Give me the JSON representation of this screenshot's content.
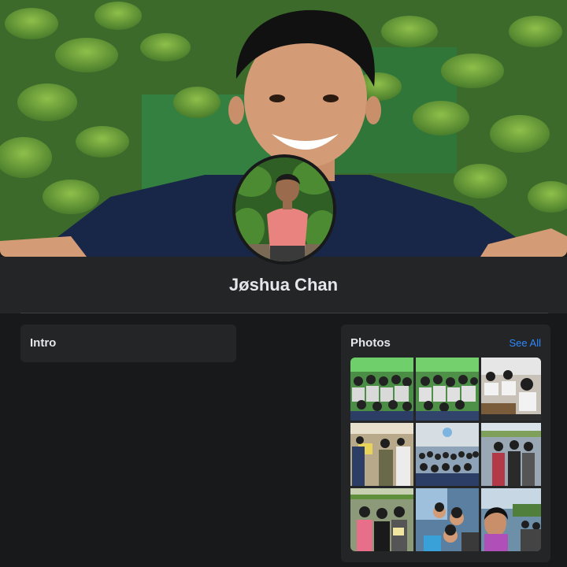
{
  "profile": {
    "name": "Jøshua Chan"
  },
  "intro": {
    "title": "Intro"
  },
  "photos": {
    "title": "Photos",
    "see_all": "See All",
    "items": [
      "classroom-group-photo",
      "classroom-group-photo",
      "students-at-desks-photo",
      "school-event-photo",
      "assembly-hall-photo",
      "friends-selfie-photo",
      "friends-posing-photo",
      "group-selfie-photo",
      "girl-selfie-photo"
    ]
  },
  "colors": {
    "background": "#18191a",
    "card": "#242526",
    "accent": "#2d88ff",
    "text": "#e4e6eb"
  }
}
